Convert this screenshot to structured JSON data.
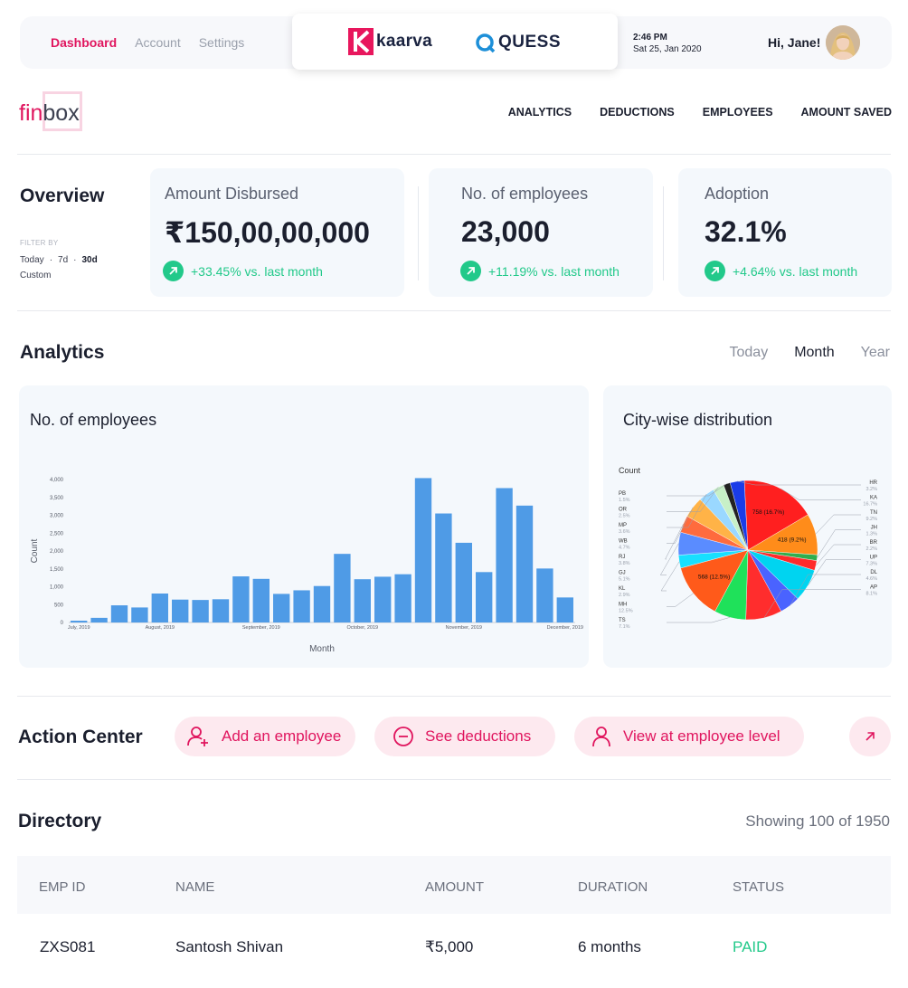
{
  "topbar": {
    "nav": [
      "Dashboard",
      "Account",
      "Settings"
    ],
    "brands": {
      "kaarva": "kaarva",
      "quess": "QUESS"
    },
    "time": "2:46 PM",
    "date": "Sat 25, Jan 2020",
    "greeting": "Hi, Jane!"
  },
  "header": {
    "logo_fin": "fin",
    "logo_box": "box",
    "nav": [
      "ANALYTICS",
      "DEDUCTIONS",
      "EMPLOYEES",
      "AMOUNT SAVED"
    ]
  },
  "overview": {
    "title": "Overview",
    "filter_label": "FILTER BY",
    "filters": [
      "Today",
      "7d",
      "30d"
    ],
    "filter_selected": "30d",
    "filter_custom": "Custom",
    "stats": [
      {
        "label": "Amount Disbursed",
        "value": "₹150,00,00,000",
        "delta": "+33.45% vs. last month"
      },
      {
        "label": "No. of employees",
        "value": "23,000",
        "delta": "+11.19% vs. last month"
      },
      {
        "label": "Adoption",
        "value": "32.1%",
        "delta": "+4.64% vs. last month"
      }
    ]
  },
  "analytics": {
    "title": "Analytics",
    "periods": [
      "Today",
      "Month",
      "Year"
    ],
    "period_selected": "Month",
    "bar_card_title": "No. of employees",
    "pie_card_title": "City-wise distribution",
    "pie_count_label": "Count"
  },
  "chart_data": [
    {
      "type": "bar",
      "xlabel": "Month",
      "ylabel": "Count",
      "ylim": [
        0,
        4000
      ],
      "yticks": [
        "0",
        "500",
        "1,000",
        "1,500",
        "2,000",
        "2,500",
        "3,000",
        "3,500",
        "4,000"
      ],
      "xticks": [
        "July, 2019",
        "August, 2019",
        "September, 2019",
        "October, 2019",
        "November, 2019",
        "December, 2019"
      ],
      "xtick_index": [
        0,
        4,
        9,
        14,
        19,
        24
      ],
      "values": [
        50,
        130,
        480,
        420,
        810,
        640,
        630,
        650,
        1290,
        1220,
        800,
        900,
        1020,
        1920,
        1210,
        1280,
        1350,
        4040,
        3050,
        2230,
        1410,
        3760,
        3270,
        1510,
        700
      ],
      "color": "#4f9be6",
      "grid": false
    },
    {
      "type": "pie",
      "title": "Count",
      "slice_labels": [
        "758 (16.7%)",
        "418 (9.2%)",
        "568 (12.5%)"
      ],
      "categories": [
        "HR",
        "KA",
        "TN",
        "JH",
        "BR",
        "UP",
        "DL",
        "AP",
        "TS",
        "MH",
        "KL",
        "GJ",
        "RJ",
        "WB",
        "MP",
        "OR",
        "PB"
      ],
      "percent_labels": [
        "3.2%",
        "16.7%",
        "9.2%",
        "1.3%",
        "2.2%",
        "7.3%",
        "4.6%",
        "8.1%",
        "7.1%",
        "12.5%",
        "2.9%",
        "5.1%",
        "3.8%",
        "4.7%",
        "3.6%",
        "2.5%",
        "1.5%"
      ],
      "values": [
        3.2,
        16.7,
        9.2,
        1.3,
        2.2,
        7.3,
        4.6,
        8.1,
        7.1,
        12.5,
        2.9,
        5.1,
        3.8,
        4.7,
        3.6,
        2.5,
        1.5
      ],
      "colors": [
        "#1a3ce8",
        "#ff1f1f",
        "#ff8c1a",
        "#2fae4e",
        "#ff2a2a",
        "#00d4f0",
        "#4a63ff",
        "#ff2d2d",
        "#1fe15a",
        "#ff5a1a",
        "#17e0ff",
        "#5a8cff",
        "#ff6b3d",
        "#ffb347",
        "#9ad8ff",
        "#c7f0c7",
        "#222222"
      ]
    }
  ],
  "action_center": {
    "title": "Action Center",
    "actions": [
      "Add an employee",
      "See deductions",
      "View at  employee level"
    ]
  },
  "directory": {
    "title": "Directory",
    "showing": "Showing 100 of 1950",
    "headers": [
      "EMP ID",
      "NAME",
      "AMOUNT",
      "DURATION",
      "STATUS"
    ],
    "rows": [
      {
        "emp_id": "ZXS081",
        "name": "Santosh Shivan",
        "amount": "₹5,000",
        "duration": "6 months",
        "status": "PAID"
      }
    ]
  }
}
